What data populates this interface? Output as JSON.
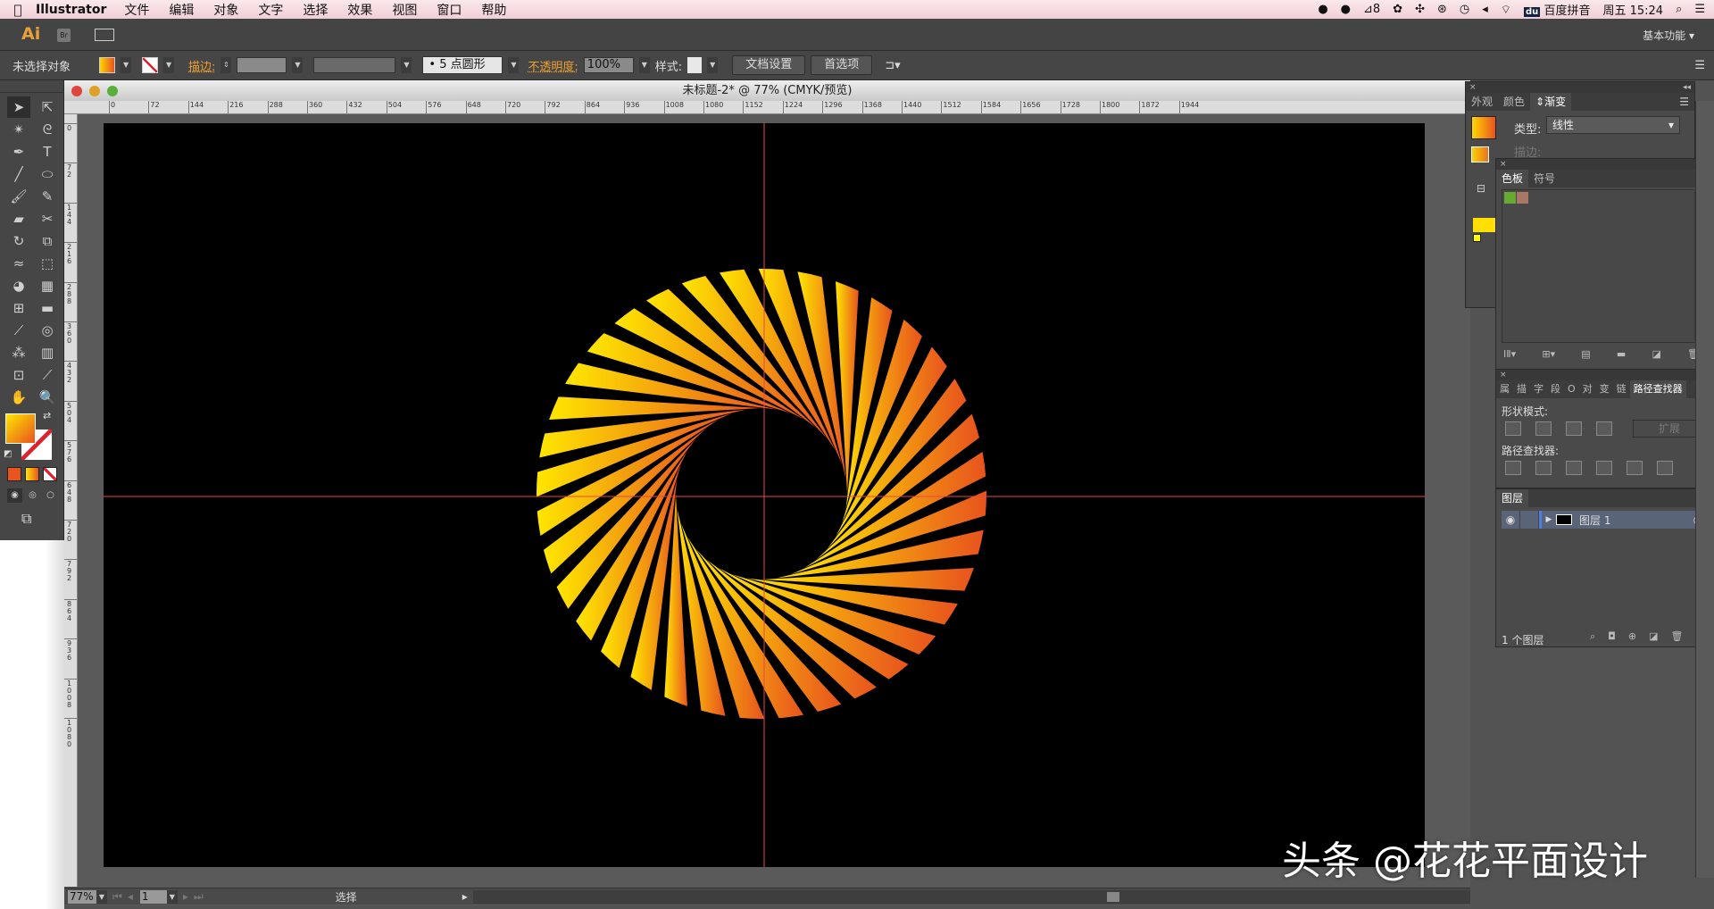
{
  "menubar": {
    "app": "Illustrator",
    "items": [
      "文件",
      "编辑",
      "对象",
      "文字",
      "选择",
      "效果",
      "视图",
      "窗口",
      "帮助"
    ],
    "badge_count": "8",
    "input_method": "百度拼音",
    "datetime": "周五 15:24"
  },
  "appbar": {
    "logo": "Ai",
    "bridge": "Br",
    "workspace": "基本功能"
  },
  "control": {
    "selection": "未选择对象",
    "stroke_label": "描边:",
    "brush": "5 点圆形",
    "opacity_label": "不透明度:",
    "opacity": "100%",
    "style_label": "样式:",
    "doc_setup": "文档设置",
    "preferences": "首选项"
  },
  "document": {
    "title": "未标题-2* @ 77% (CMYK/预览)",
    "zoom": "77%",
    "page": "1",
    "status": "选择",
    "ruler_h": [
      "0",
      "72",
      "144",
      "216",
      "288",
      "360",
      "432",
      "504",
      "576",
      "648",
      "720",
      "792",
      "864",
      "936",
      "1008",
      "1080",
      "1152",
      "1224",
      "1296",
      "1368",
      "1440",
      "1512",
      "1584",
      "1656",
      "1728",
      "1800",
      "1872",
      "1944"
    ],
    "ruler_v": [
      "0",
      "72",
      "144",
      "216",
      "288",
      "360",
      "432",
      "504",
      "576",
      "648",
      "720",
      "792",
      "864",
      "936",
      "1008",
      "1080"
    ]
  },
  "artwork": {
    "strip_count": 36,
    "gradient_start": "#ffe600",
    "gradient_end": "#e8531e",
    "guide_color": "#e8484a"
  },
  "gradient_panel": {
    "tabs": [
      "外观",
      "颜色",
      "渐变"
    ],
    "type_label": "类型:",
    "type_value": "线性",
    "stroke_label": "描边:"
  },
  "swatches_panel": {
    "tabs": [
      "色板",
      "符号"
    ]
  },
  "pathfinder_panel": {
    "tabs": [
      "属",
      "描",
      "字",
      "段",
      "O",
      "对",
      "变",
      "链",
      "路径查找器"
    ],
    "shape_modes": "形状模式:",
    "expand": "扩展",
    "pathfinders": "路径查找器:"
  },
  "layers_panel": {
    "title": "图层",
    "layer_name": "图层 1",
    "count": "1 个图层"
  },
  "watermark": "头条 @花花平面设计"
}
